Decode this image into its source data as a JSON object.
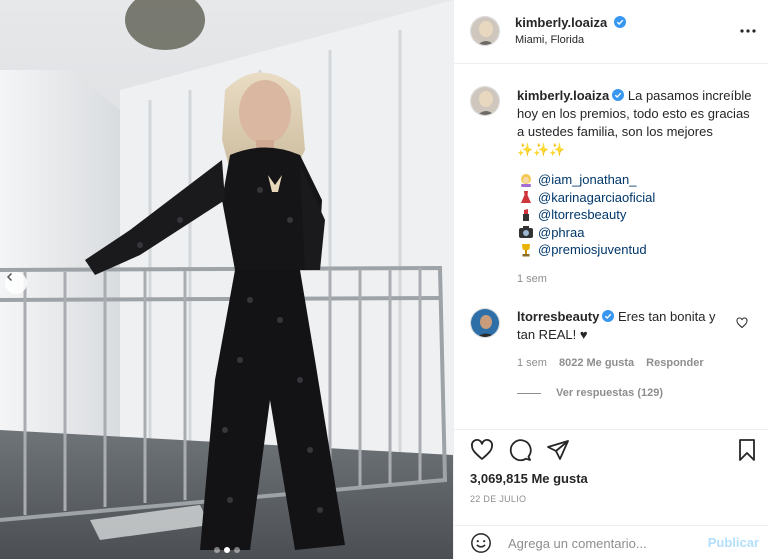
{
  "post": {
    "username": "kimberly.loaiza",
    "location": "Miami, Florida",
    "verified": true,
    "photo_icon": "photo-of-woman-in-black-sequin-jumpsuit"
  },
  "caption": {
    "username": "kimberly.loaiza",
    "text": "La pasamos increíble hoy en los premios, todo esto es gracias a ustedes familia, son los mejores",
    "trailing_emoji": "✨✨✨",
    "tags": [
      {
        "icon": "person-blond-emoji",
        "handle": "@iam_jonathan_"
      },
      {
        "icon": "dress-emoji",
        "handle": "@karinagarciaoficial"
      },
      {
        "icon": "lipstick-emoji",
        "handle": "@ltorresbeauty"
      },
      {
        "icon": "camera-emoji",
        "handle": "@phraa"
      },
      {
        "icon": "trophy-emoji",
        "handle": "@premiosjuventud"
      }
    ],
    "age": "1 sem"
  },
  "reply": {
    "username": "ltorresbeauty",
    "text": "Eres tan bonita y tan REAL! ♥",
    "age": "1 sem",
    "likes": "8022 Me gusta",
    "reply_label": "Responder",
    "view_replies": "Ver respuestas (129)"
  },
  "actions": {
    "likes": "3,069,815 Me gusta",
    "date": "22 DE JULIO"
  },
  "composer": {
    "placeholder": "Agrega un comentario...",
    "publish_label": "Publicar"
  },
  "colors": {
    "link": "#00376b",
    "verified": "#3897f0",
    "muted": "#8e8e8e",
    "publish_disabled": "#b2dffc"
  },
  "carousel": {
    "total_slides": 3,
    "active_slide": 2
  }
}
